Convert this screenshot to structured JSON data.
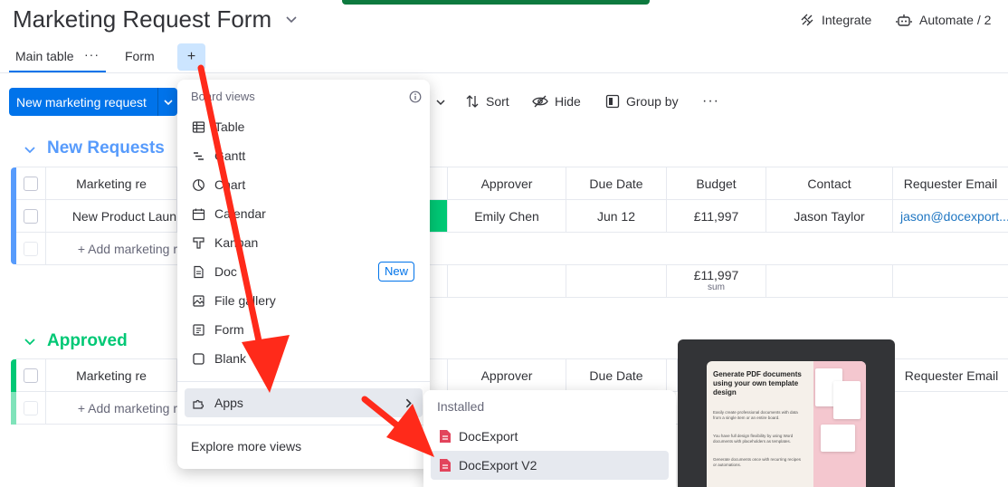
{
  "header": {
    "board_title": "Marketing Request Form",
    "integrate_label": "Integrate",
    "automate_label": "Automate / 2"
  },
  "tabs": [
    {
      "label": "Main table",
      "active": true
    },
    {
      "label": "Form",
      "active": false
    }
  ],
  "add_view_symbol": "+",
  "toolbar": {
    "new_item_label": "New marketing request",
    "sort_label": "Sort",
    "hide_label": "Hide",
    "group_by_label": "Group by",
    "more_symbol": "···"
  },
  "groups": [
    {
      "title": "New Requests",
      "color": "#579bfc",
      "columns": [
        "Marketing re",
        "Approver",
        "Due Date",
        "Budget",
        "Contact",
        "Requester Email"
      ],
      "rows": [
        {
          "name": "New Product Laun",
          "status_color": "#00c875",
          "approver": "Emily Chen",
          "due_date": "Jun 12",
          "budget": "£11,997",
          "contact": "Jason Taylor",
          "email": "jason@docexport..."
        }
      ],
      "add_item_label": "+ Add marketing r",
      "summary": {
        "budget": "£11,997",
        "budget_label": "sum"
      }
    },
    {
      "title": "Approved",
      "color": "#00c875",
      "columns": [
        "Marketing re",
        "Approver",
        "Due Date",
        "Requester Email"
      ],
      "add_item_label": "+ Add marketing r"
    }
  ],
  "views_menu": {
    "heading": "Board views",
    "items": [
      {
        "label": "Table",
        "icon": "table-icon"
      },
      {
        "label": "Gantt",
        "icon": "gantt-icon"
      },
      {
        "label": "Chart",
        "icon": "chart-icon"
      },
      {
        "label": "Calendar",
        "icon": "calendar-icon"
      },
      {
        "label": "Kanban",
        "icon": "kanban-icon"
      },
      {
        "label": "Doc",
        "icon": "doc-icon",
        "badge": "New"
      },
      {
        "label": "File gallery",
        "icon": "file-gallery-icon"
      },
      {
        "label": "Form",
        "icon": "form-icon"
      },
      {
        "label": "Blank",
        "icon": "blank-icon"
      }
    ],
    "apps_label": "Apps",
    "footer_label": "Explore more views"
  },
  "apps_submenu": {
    "heading": "Installed",
    "items": [
      {
        "label": "DocExport",
        "icon": "docexport-icon"
      },
      {
        "label": "DocExport V2",
        "icon": "docexport-icon",
        "highlighted": true
      }
    ]
  },
  "preview": {
    "title": "Generate PDF documents using your own template design",
    "lines": [
      "Easily create professional documents with data from a single item or an entire board.",
      "You have full design flexibility by using Word documents with placeholders as templates.",
      "Generate documents once with recurring recipes or automations."
    ]
  },
  "colors": {
    "primary": "#0073ea",
    "annotation_arrow": "#ff2a1a"
  }
}
